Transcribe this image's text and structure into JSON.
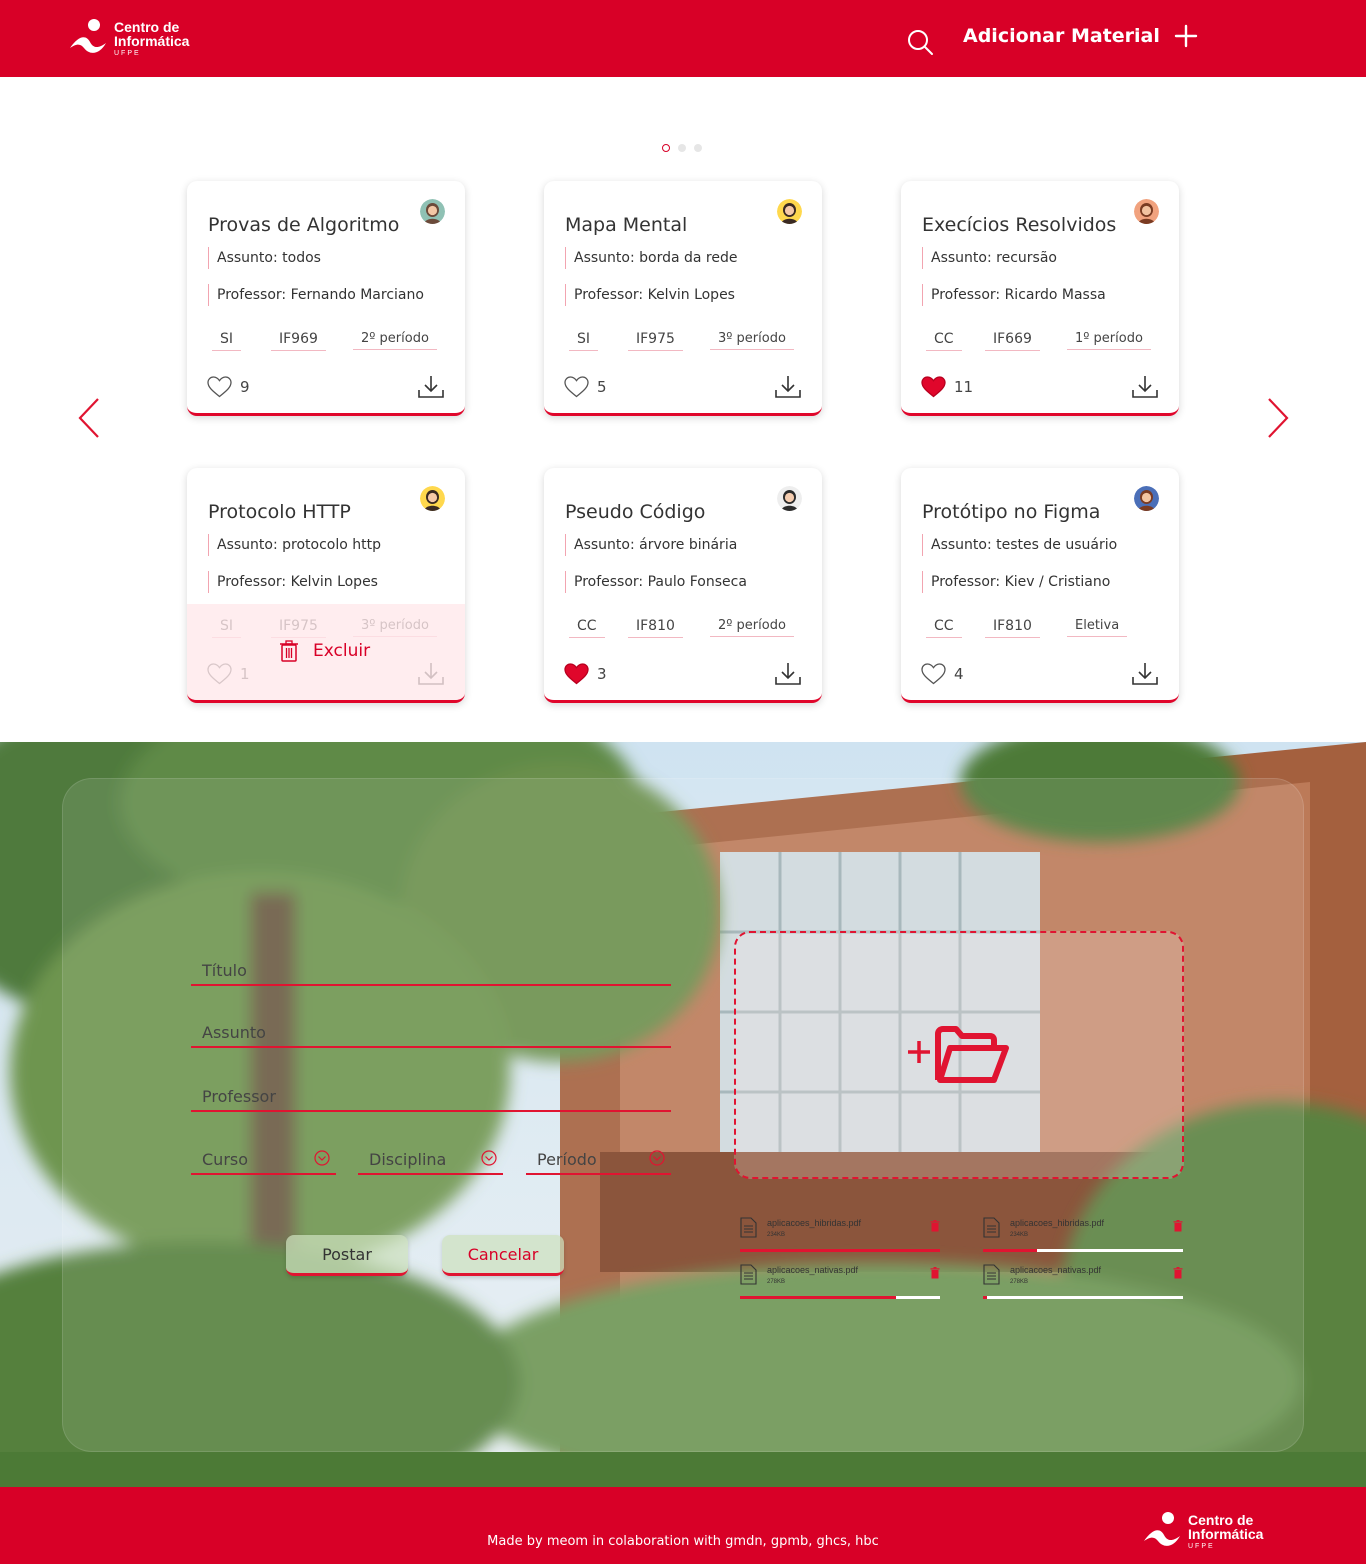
{
  "header": {
    "logo": {
      "line1": "Centro de",
      "line2": "Informática",
      "line3": "UFPE"
    },
    "add_label": "Adicionar Material"
  },
  "carousel": {
    "page_count": 3,
    "active_page": 1,
    "cards": [
      {
        "title": "Provas de Algoritmo",
        "assunto": "Assunto: todos",
        "professor": "Professor: Fernando Marciano",
        "tags": [
          "SI",
          "IF969",
          "2º período"
        ],
        "likes": "9",
        "liked": false,
        "avatar": "avatar-woman-green"
      },
      {
        "title": "Mapa Mental",
        "assunto": "Assunto: borda da rede",
        "professor": "Professor: Kelvin Lopes",
        "tags": [
          "SI",
          "IF975",
          "3º período"
        ],
        "likes": "5",
        "liked": false,
        "avatar": "avatar-woman-yellow"
      },
      {
        "title": "Execícios Resolvidos",
        "assunto": "Assunto: recursão",
        "professor": "Professor: Ricardo Massa",
        "tags": [
          "CC",
          "IF669",
          "1º período"
        ],
        "likes": "11",
        "liked": true,
        "avatar": "avatar-man-orange"
      },
      {
        "title": "Protocolo HTTP",
        "assunto": "Assunto: protocolo http",
        "professor": "Professor: Kelvin Lopes",
        "tags": [
          "SI",
          "IF975",
          "3º período"
        ],
        "likes": "1",
        "liked": false,
        "avatar": "avatar-woman-yellow",
        "delete_label": "Excluir"
      },
      {
        "title": "Pseudo Código",
        "assunto": "Assunto: árvore binária",
        "professor": "Professor: Paulo Fonseca",
        "tags": [
          "CC",
          "IF810",
          "2º período"
        ],
        "likes": "3",
        "liked": true,
        "avatar": "avatar-man-suit"
      },
      {
        "title": "Protótipo no Figma",
        "assunto": "Assunto: testes de usuário",
        "professor": "Professor: Kiev / Cristiano",
        "tags": [
          "CC",
          "IF810",
          "Eletiva"
        ],
        "likes": "4",
        "liked": false,
        "avatar": "avatar-woman-blue"
      }
    ]
  },
  "form": {
    "titulo_label": "Título",
    "assunto_label": "Assunto",
    "professor_label": "Professor",
    "curso_label": "Curso",
    "disciplina_label": "Disciplina",
    "periodo_label": "Período",
    "post_label": "Postar",
    "cancel_label": "Cancelar",
    "upload_icon": "add-folder-icon",
    "files": [
      {
        "name": "aplicacoes_hibridas.pdf",
        "size": "234KB",
        "progress": 1.0
      },
      {
        "name": "aplicacoes_hibridas.pdf",
        "size": "234KB",
        "progress": 0.27
      },
      {
        "name": "aplicacoes_nativas.pdf",
        "size": "278KB",
        "progress": 0.78
      },
      {
        "name": "aplicacoes_nativas.pdf",
        "size": "278KB",
        "progress": 0.02
      }
    ]
  },
  "footer": {
    "credit": "Made by meom in colaboration with gmdn, gpmb, ghcs, hbc",
    "logo": {
      "line1": "Centro de",
      "line2": "Informática",
      "line3": "UFPE"
    }
  },
  "colors": {
    "brand": "#d80027",
    "accent_line": "#e01431"
  }
}
